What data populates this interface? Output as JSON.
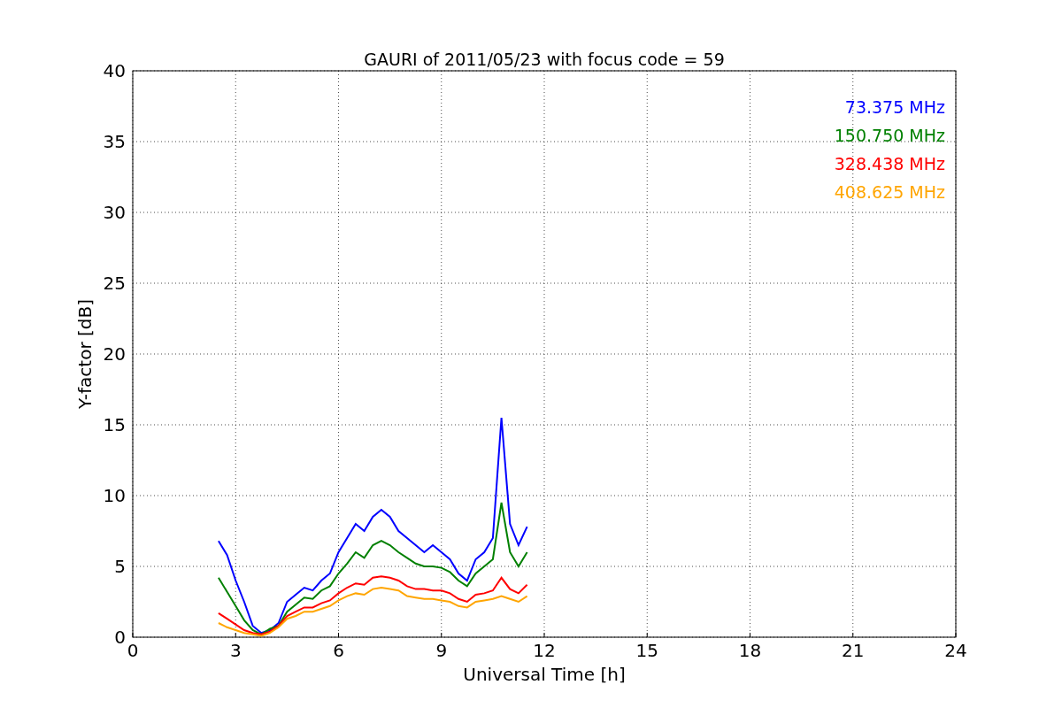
{
  "chart_data": {
    "type": "line",
    "title": "GAURI of 2011/05/23 with focus code = 59",
    "xlabel": "Universal Time [h]",
    "ylabel": "Y-factor [dB]",
    "x": [
      2.5,
      2.75,
      3.0,
      3.25,
      3.5,
      3.75,
      4.0,
      4.25,
      4.5,
      4.75,
      5.0,
      5.25,
      5.5,
      5.75,
      6.0,
      6.25,
      6.5,
      6.75,
      7.0,
      7.25,
      7.5,
      7.75,
      8.0,
      8.25,
      8.5,
      8.75,
      9.0,
      9.25,
      9.5,
      9.75,
      10.0,
      10.25,
      10.5,
      10.75,
      11.0,
      11.25,
      11.5
    ],
    "series": [
      {
        "name": "73.375 MHz",
        "color": "#0000ff",
        "values": [
          6.8,
          5.8,
          4.0,
          2.5,
          0.8,
          0.3,
          0.5,
          1.0,
          2.5,
          3.0,
          3.5,
          3.3,
          4.0,
          4.5,
          6.0,
          7.0,
          8.0,
          7.5,
          8.5,
          9.0,
          8.5,
          7.5,
          7.0,
          6.5,
          6.0,
          6.5,
          6.0,
          5.5,
          4.5,
          4.0,
          5.5,
          6.0,
          7.0,
          15.5,
          8.0,
          6.5,
          7.8
        ]
      },
      {
        "name": "150.750 MHz",
        "color": "#008000",
        "values": [
          4.2,
          3.2,
          2.2,
          1.2,
          0.5,
          0.2,
          0.6,
          0.8,
          1.8,
          2.3,
          2.8,
          2.7,
          3.3,
          3.6,
          4.5,
          5.2,
          6.0,
          5.6,
          6.5,
          6.8,
          6.5,
          6.0,
          5.6,
          5.2,
          5.0,
          5.0,
          4.9,
          4.6,
          4.0,
          3.6,
          4.5,
          5.0,
          5.5,
          9.5,
          6.0,
          5.0,
          6.0
        ]
      },
      {
        "name": "328.438 MHz",
        "color": "#ff0000",
        "values": [
          1.7,
          1.3,
          0.9,
          0.5,
          0.3,
          0.2,
          0.4,
          0.8,
          1.5,
          1.8,
          2.1,
          2.1,
          2.4,
          2.6,
          3.1,
          3.5,
          3.8,
          3.7,
          4.2,
          4.3,
          4.2,
          4.0,
          3.6,
          3.4,
          3.4,
          3.3,
          3.3,
          3.1,
          2.7,
          2.5,
          3.0,
          3.1,
          3.3,
          4.2,
          3.4,
          3.1,
          3.7
        ]
      },
      {
        "name": "408.625 MHz",
        "color": "#ffa500",
        "values": [
          1.0,
          0.7,
          0.5,
          0.3,
          0.2,
          0.1,
          0.3,
          0.7,
          1.3,
          1.5,
          1.8,
          1.8,
          2.0,
          2.2,
          2.6,
          2.9,
          3.1,
          3.0,
          3.4,
          3.5,
          3.4,
          3.3,
          2.9,
          2.8,
          2.7,
          2.7,
          2.6,
          2.5,
          2.2,
          2.1,
          2.5,
          2.6,
          2.7,
          2.9,
          2.7,
          2.5,
          2.9
        ]
      }
    ],
    "xlim": [
      0,
      24
    ],
    "ylim": [
      0,
      40
    ],
    "xticks": [
      0,
      3,
      6,
      9,
      12,
      15,
      18,
      21,
      24
    ],
    "yticks": [
      0,
      5,
      10,
      15,
      20,
      25,
      30,
      35,
      40
    ],
    "grid": true
  }
}
